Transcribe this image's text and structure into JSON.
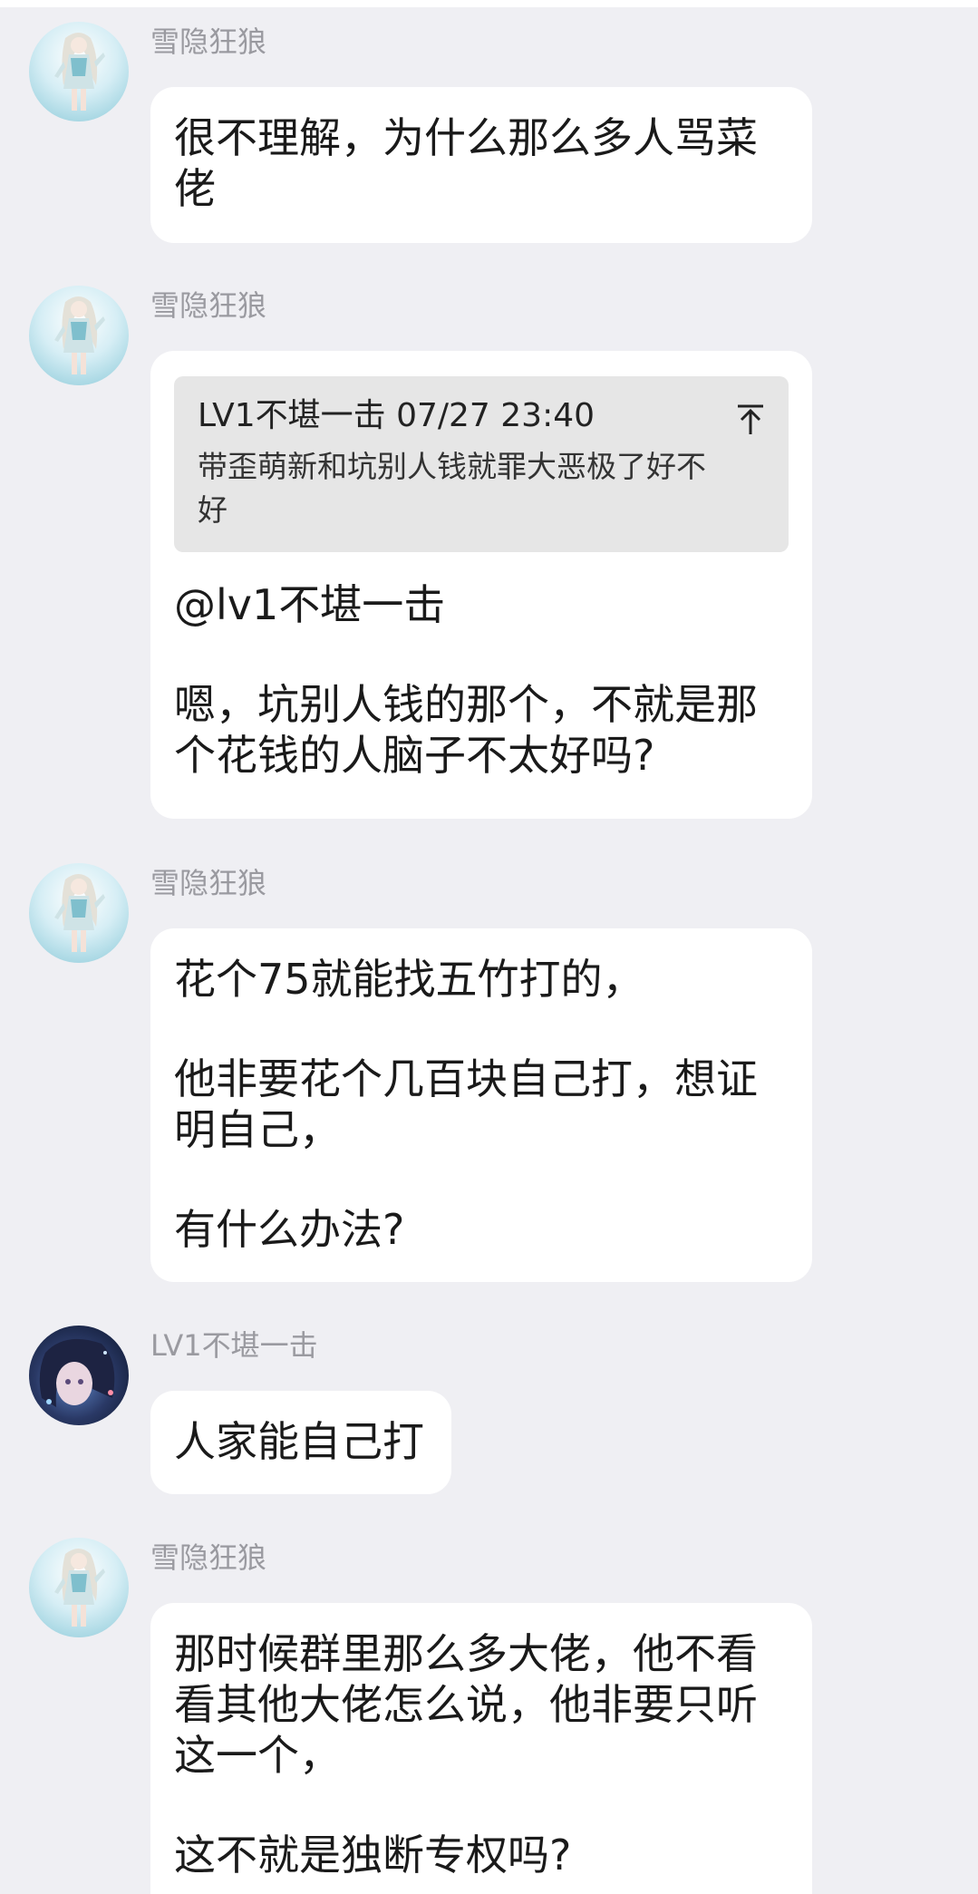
{
  "colors": {
    "background": "#efeff3",
    "bubble": "#ffffff",
    "quote_bg": "#e6e6e6",
    "sender_name": "#9a9aa0",
    "text": "#1a1a1a"
  },
  "messages": [
    {
      "avatar": "anime-girl-avatar-icon",
      "sender": "雪隐狂狼",
      "lines": [
        "很不理解，为什么那么多人骂菜",
        "佬"
      ]
    },
    {
      "avatar": "anime-girl-avatar-icon",
      "sender": "雪隐狂狼",
      "quote": {
        "header": "LV1不堪一击 07/27 23:40",
        "text_lines": [
          "带歪萌新和坑别人钱就罪大恶极了好不",
          "好"
        ],
        "icon": "jump-to-top-icon"
      },
      "mention": "@lv1不堪一击",
      "lines": [
        "嗯，坑别人钱的那个，不就是那",
        "个花钱的人脑子不太好吗?"
      ]
    },
    {
      "avatar": "anime-girl-avatar-icon",
      "sender": "雪隐狂狼",
      "para1": "花个75就能找五竹打的，",
      "para2_lines": [
        "他非要花个几百块自己打，想证",
        "明自己，"
      ],
      "para3": "有什么办法?"
    },
    {
      "avatar": "dark-haired-avatar-icon",
      "sender": "LV1不堪一击",
      "text": "人家能自己打"
    },
    {
      "avatar": "anime-girl-avatar-icon",
      "sender": "雪隐狂狼",
      "para1_lines": [
        "那时候群里那么多大佬，他不看",
        "看其他大佬怎么说，他非要只听",
        "这一个，"
      ],
      "para2": "这不就是独断专权吗?"
    }
  ]
}
